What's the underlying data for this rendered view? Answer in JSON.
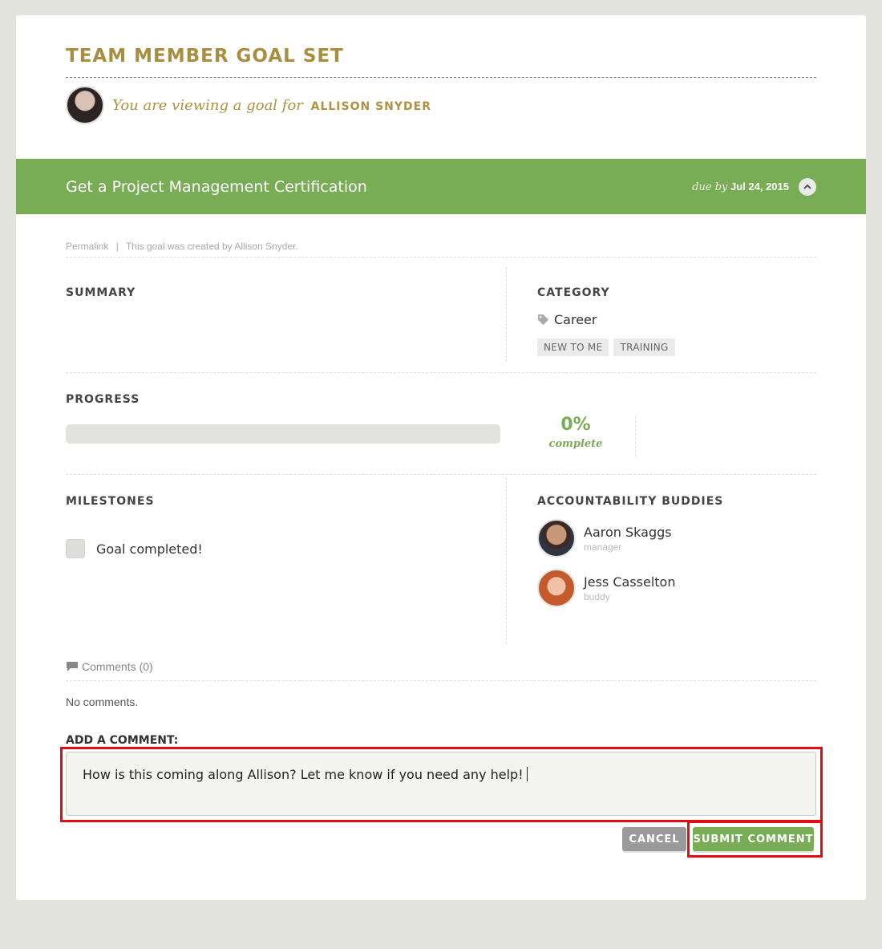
{
  "header": {
    "title": "TEAM MEMBER GOAL SET",
    "viewing_prefix": "You are viewing a goal for",
    "viewing_name": "ALLISON SNYDER"
  },
  "goal": {
    "title": "Get a Project Management Certification",
    "due_label": "due by",
    "due_date": "Jul 24, 2015",
    "color": "#78ad55"
  },
  "meta": {
    "permalink": "Permalink",
    "separator": "|",
    "created_by": "This goal was created by Allison Snyder."
  },
  "summary": {
    "heading": "SUMMARY"
  },
  "category": {
    "heading": "CATEGORY",
    "icon": "tag-icon",
    "value": "Career",
    "tags": [
      "NEW TO ME",
      "TRAINING"
    ]
  },
  "progress": {
    "heading": "PROGRESS",
    "value": 0,
    "percent_text": "0%",
    "label": "complete"
  },
  "milestones": {
    "heading": "MILESTONES",
    "items": [
      {
        "label": "Goal completed!",
        "checked": false
      }
    ]
  },
  "buddies": {
    "heading": "ACCOUNTABILITY BUDDIES",
    "items": [
      {
        "name": "Aaron Skaggs",
        "role": "manager"
      },
      {
        "name": "Jess Casselton",
        "role": "buddy"
      }
    ]
  },
  "comments": {
    "icon": "comment-icon",
    "heading": "Comments (0)",
    "empty_text": "No comments.",
    "add_label": "ADD A COMMENT:",
    "draft": "How is this coming along Allison? Let me know if you need any help!"
  },
  "actions": {
    "cancel_label": "CANCEL",
    "submit_label": "SUBMIT COMMENT"
  }
}
